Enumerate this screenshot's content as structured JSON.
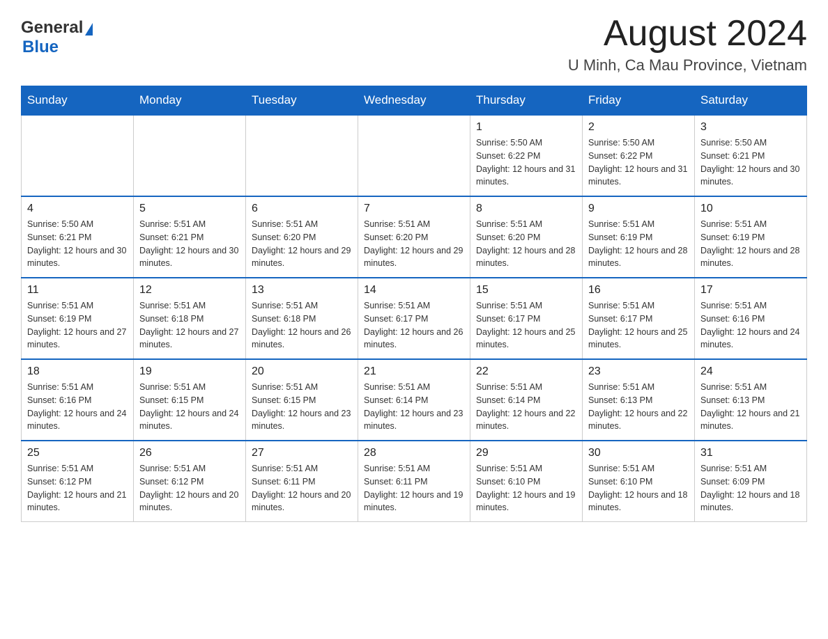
{
  "header": {
    "logo_general": "General",
    "logo_blue": "Blue",
    "month_title": "August 2024",
    "location": "U Minh, Ca Mau Province, Vietnam"
  },
  "days_of_week": [
    "Sunday",
    "Monday",
    "Tuesday",
    "Wednesday",
    "Thursday",
    "Friday",
    "Saturday"
  ],
  "weeks": [
    [
      {
        "day": "",
        "info": ""
      },
      {
        "day": "",
        "info": ""
      },
      {
        "day": "",
        "info": ""
      },
      {
        "day": "",
        "info": ""
      },
      {
        "day": "1",
        "info": "Sunrise: 5:50 AM\nSunset: 6:22 PM\nDaylight: 12 hours and 31 minutes."
      },
      {
        "day": "2",
        "info": "Sunrise: 5:50 AM\nSunset: 6:22 PM\nDaylight: 12 hours and 31 minutes."
      },
      {
        "day": "3",
        "info": "Sunrise: 5:50 AM\nSunset: 6:21 PM\nDaylight: 12 hours and 30 minutes."
      }
    ],
    [
      {
        "day": "4",
        "info": "Sunrise: 5:50 AM\nSunset: 6:21 PM\nDaylight: 12 hours and 30 minutes."
      },
      {
        "day": "5",
        "info": "Sunrise: 5:51 AM\nSunset: 6:21 PM\nDaylight: 12 hours and 30 minutes."
      },
      {
        "day": "6",
        "info": "Sunrise: 5:51 AM\nSunset: 6:20 PM\nDaylight: 12 hours and 29 minutes."
      },
      {
        "day": "7",
        "info": "Sunrise: 5:51 AM\nSunset: 6:20 PM\nDaylight: 12 hours and 29 minutes."
      },
      {
        "day": "8",
        "info": "Sunrise: 5:51 AM\nSunset: 6:20 PM\nDaylight: 12 hours and 28 minutes."
      },
      {
        "day": "9",
        "info": "Sunrise: 5:51 AM\nSunset: 6:19 PM\nDaylight: 12 hours and 28 minutes."
      },
      {
        "day": "10",
        "info": "Sunrise: 5:51 AM\nSunset: 6:19 PM\nDaylight: 12 hours and 28 minutes."
      }
    ],
    [
      {
        "day": "11",
        "info": "Sunrise: 5:51 AM\nSunset: 6:19 PM\nDaylight: 12 hours and 27 minutes."
      },
      {
        "day": "12",
        "info": "Sunrise: 5:51 AM\nSunset: 6:18 PM\nDaylight: 12 hours and 27 minutes."
      },
      {
        "day": "13",
        "info": "Sunrise: 5:51 AM\nSunset: 6:18 PM\nDaylight: 12 hours and 26 minutes."
      },
      {
        "day": "14",
        "info": "Sunrise: 5:51 AM\nSunset: 6:17 PM\nDaylight: 12 hours and 26 minutes."
      },
      {
        "day": "15",
        "info": "Sunrise: 5:51 AM\nSunset: 6:17 PM\nDaylight: 12 hours and 25 minutes."
      },
      {
        "day": "16",
        "info": "Sunrise: 5:51 AM\nSunset: 6:17 PM\nDaylight: 12 hours and 25 minutes."
      },
      {
        "day": "17",
        "info": "Sunrise: 5:51 AM\nSunset: 6:16 PM\nDaylight: 12 hours and 24 minutes."
      }
    ],
    [
      {
        "day": "18",
        "info": "Sunrise: 5:51 AM\nSunset: 6:16 PM\nDaylight: 12 hours and 24 minutes."
      },
      {
        "day": "19",
        "info": "Sunrise: 5:51 AM\nSunset: 6:15 PM\nDaylight: 12 hours and 24 minutes."
      },
      {
        "day": "20",
        "info": "Sunrise: 5:51 AM\nSunset: 6:15 PM\nDaylight: 12 hours and 23 minutes."
      },
      {
        "day": "21",
        "info": "Sunrise: 5:51 AM\nSunset: 6:14 PM\nDaylight: 12 hours and 23 minutes."
      },
      {
        "day": "22",
        "info": "Sunrise: 5:51 AM\nSunset: 6:14 PM\nDaylight: 12 hours and 22 minutes."
      },
      {
        "day": "23",
        "info": "Sunrise: 5:51 AM\nSunset: 6:13 PM\nDaylight: 12 hours and 22 minutes."
      },
      {
        "day": "24",
        "info": "Sunrise: 5:51 AM\nSunset: 6:13 PM\nDaylight: 12 hours and 21 minutes."
      }
    ],
    [
      {
        "day": "25",
        "info": "Sunrise: 5:51 AM\nSunset: 6:12 PM\nDaylight: 12 hours and 21 minutes."
      },
      {
        "day": "26",
        "info": "Sunrise: 5:51 AM\nSunset: 6:12 PM\nDaylight: 12 hours and 20 minutes."
      },
      {
        "day": "27",
        "info": "Sunrise: 5:51 AM\nSunset: 6:11 PM\nDaylight: 12 hours and 20 minutes."
      },
      {
        "day": "28",
        "info": "Sunrise: 5:51 AM\nSunset: 6:11 PM\nDaylight: 12 hours and 19 minutes."
      },
      {
        "day": "29",
        "info": "Sunrise: 5:51 AM\nSunset: 6:10 PM\nDaylight: 12 hours and 19 minutes."
      },
      {
        "day": "30",
        "info": "Sunrise: 5:51 AM\nSunset: 6:10 PM\nDaylight: 12 hours and 18 minutes."
      },
      {
        "day": "31",
        "info": "Sunrise: 5:51 AM\nSunset: 6:09 PM\nDaylight: 12 hours and 18 minutes."
      }
    ]
  ]
}
